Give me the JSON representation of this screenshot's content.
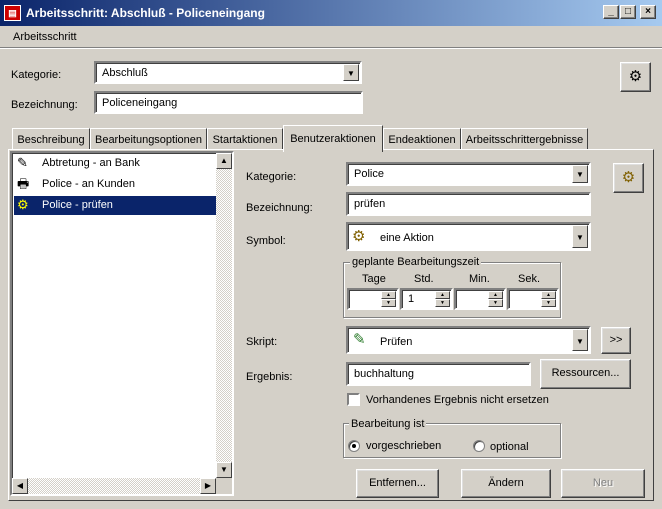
{
  "window": {
    "title": "Arbeitsschritt: Abschluß - Policeneingang",
    "min_glyph": "_",
    "max_glyph": "□",
    "close_glyph": "×"
  },
  "menu": {
    "items": [
      {
        "label": "Arbeitsschritt"
      }
    ]
  },
  "header": {
    "kategorie_label": "Kategorie:",
    "kategorie_value": "Abschluß",
    "bezeichnung_label": "Bezeichnung:",
    "bezeichnung_value": "Policeneingang"
  },
  "tabs": [
    {
      "label": "Beschreibung"
    },
    {
      "label": "Bearbeitungsoptionen"
    },
    {
      "label": "Startaktionen"
    },
    {
      "label": "Benutzeraktionen"
    },
    {
      "label": "Endeaktionen"
    },
    {
      "label": "Arbeitsschrittergebnisse"
    }
  ],
  "active_tab": "Benutzeraktionen",
  "action_list": [
    {
      "label": "Abtretung - an Bank",
      "icon": "pen-icon"
    },
    {
      "label": "Police - an Kunden",
      "icon": "printer-icon"
    },
    {
      "label": "Police - prüfen",
      "icon": "gears-icon"
    }
  ],
  "detail": {
    "kategorie_label": "Kategorie:",
    "kategorie_value": "Police",
    "bezeichnung_label": "Bezeichnung:",
    "bezeichnung_value": "prüfen",
    "symbol_label": "Symbol:",
    "symbol_value": "eine Aktion",
    "zeit_group_title": "geplante Bearbeitungszeit",
    "tage_label": "Tage",
    "std_label": "Std.",
    "min_label": "Min.",
    "sek_label": "Sek.",
    "tage_value": "",
    "std_value": "1",
    "min_value": "",
    "sek_value": "",
    "skript_label": "Skript:",
    "skript_value": "Prüfen",
    "skript_more": ">>",
    "ergebnis_label": "Ergebnis:",
    "ergebnis_value": "buchhaltung",
    "ressourcen_label": "Ressourcen...",
    "nicht_ersetzen_label": "Vorhandenes Ergebnis nicht ersetzen",
    "bearbeitung_group_title": "Bearbeitung ist",
    "vorgeschrieben_label": "vorgeschrieben",
    "optional_label": "optional",
    "selected_mode": "vorgeschrieben"
  },
  "buttons": {
    "entfernen": "Entfernen...",
    "aendern": "Ändern",
    "neu": "Neu"
  },
  "colors": {
    "titlebar_start": "#0a246a",
    "titlebar_end": "#a6caf0",
    "selection": "#0a246a",
    "face": "#d4d0c8"
  }
}
